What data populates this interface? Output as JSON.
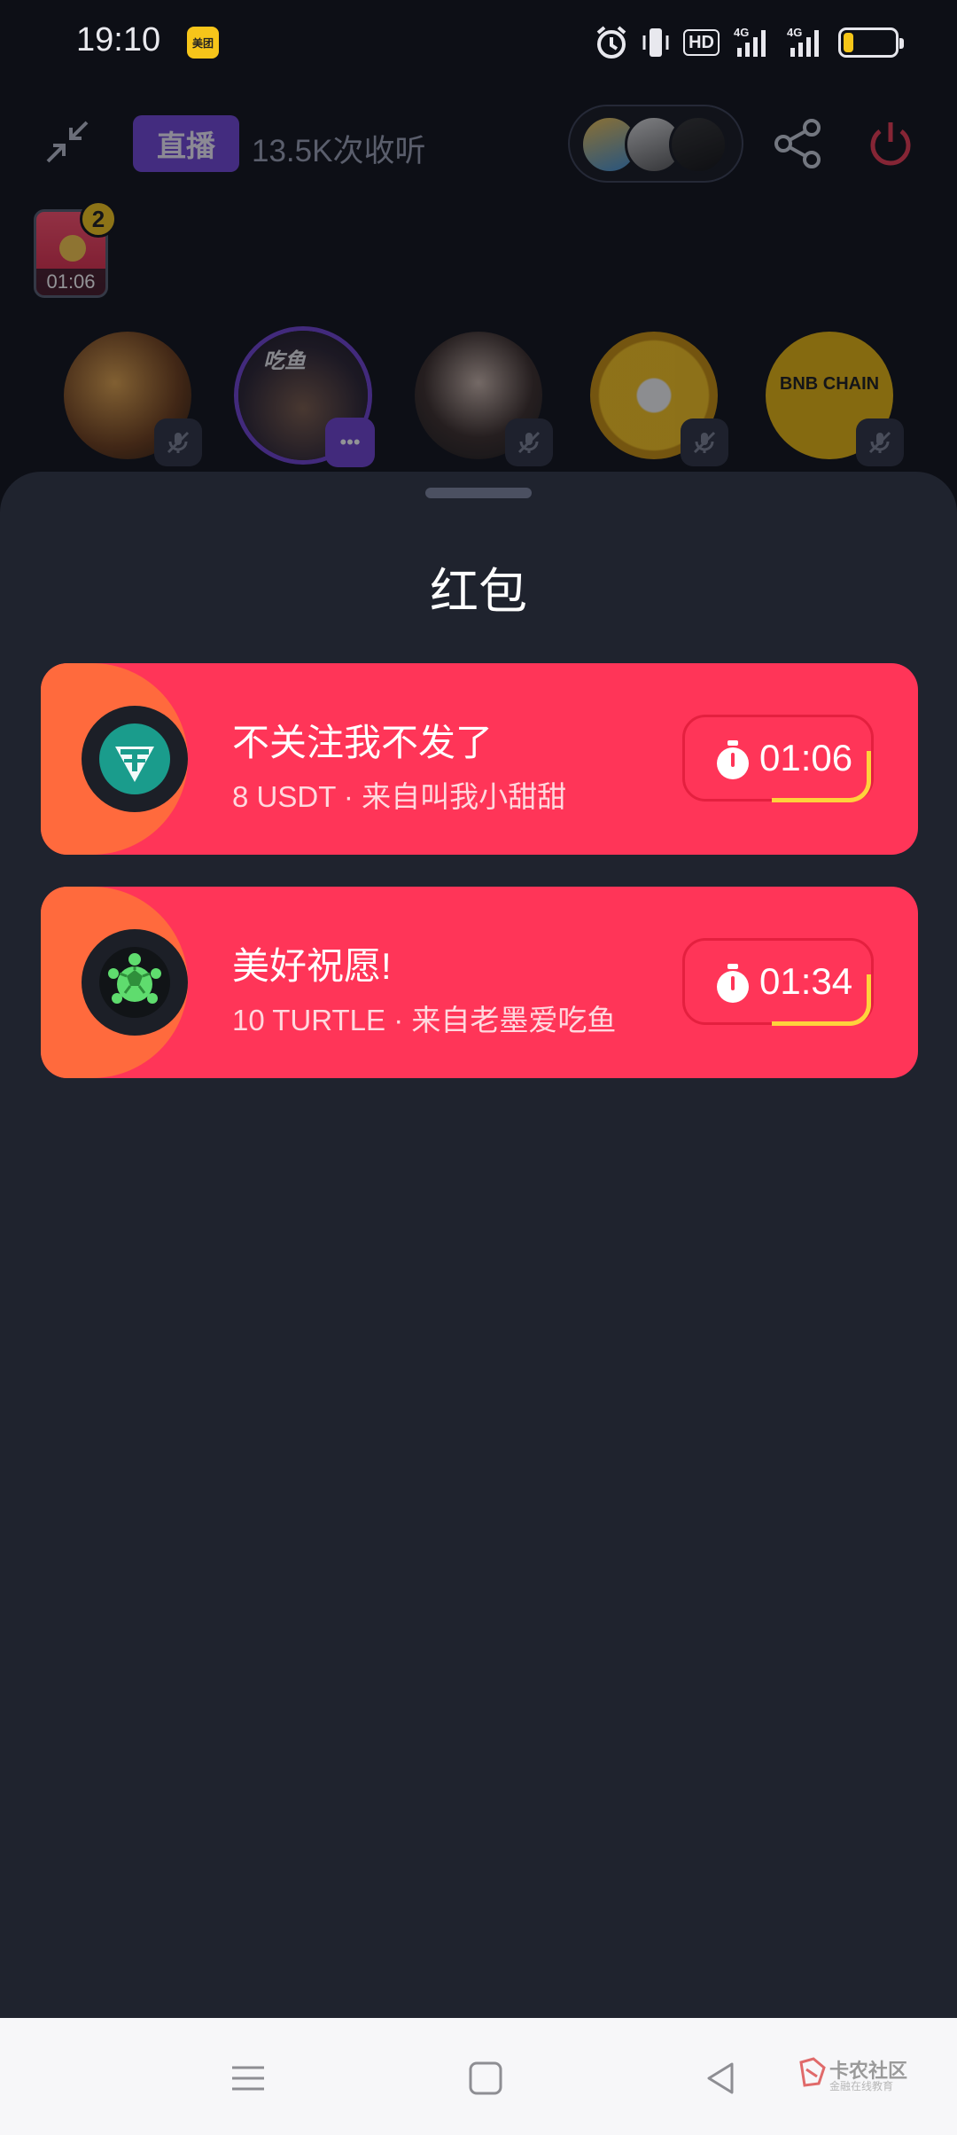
{
  "status_bar": {
    "time": "19:10",
    "app_badge": "美团",
    "network_1": "4G",
    "network_2": "4G",
    "hd_label": "HD",
    "battery_level": 0.2
  },
  "room": {
    "live_label": "直播",
    "listen_count": "13.5K次收听",
    "mini_packet_timer": "01:06",
    "mini_packet_count": "2",
    "speaker_text": "吃鱼",
    "speaker_label_4": "BNB CHAIN"
  },
  "sheet": {
    "title": "红包",
    "packets": [
      {
        "title": "不关注我不发了",
        "subtitle": "8 USDT · 来自叫我小甜甜",
        "timer": "01:06",
        "token": "USDT",
        "token_color": "#1a9c8c"
      },
      {
        "title": "美好祝愿!",
        "subtitle": "10 TURTLE · 来自老墨爱吃鱼",
        "timer": "01:34",
        "token": "TURTLE",
        "token_color": "#5fdc6e"
      }
    ]
  },
  "nav": {
    "watermark": "卡农社区",
    "watermark_sub": "金融在线教育"
  },
  "colors": {
    "packet_red": "#ff3558",
    "packet_orange": "#ff6a3d",
    "live_purple": "#7045d6",
    "timer_yellow": "#ffd23c"
  }
}
